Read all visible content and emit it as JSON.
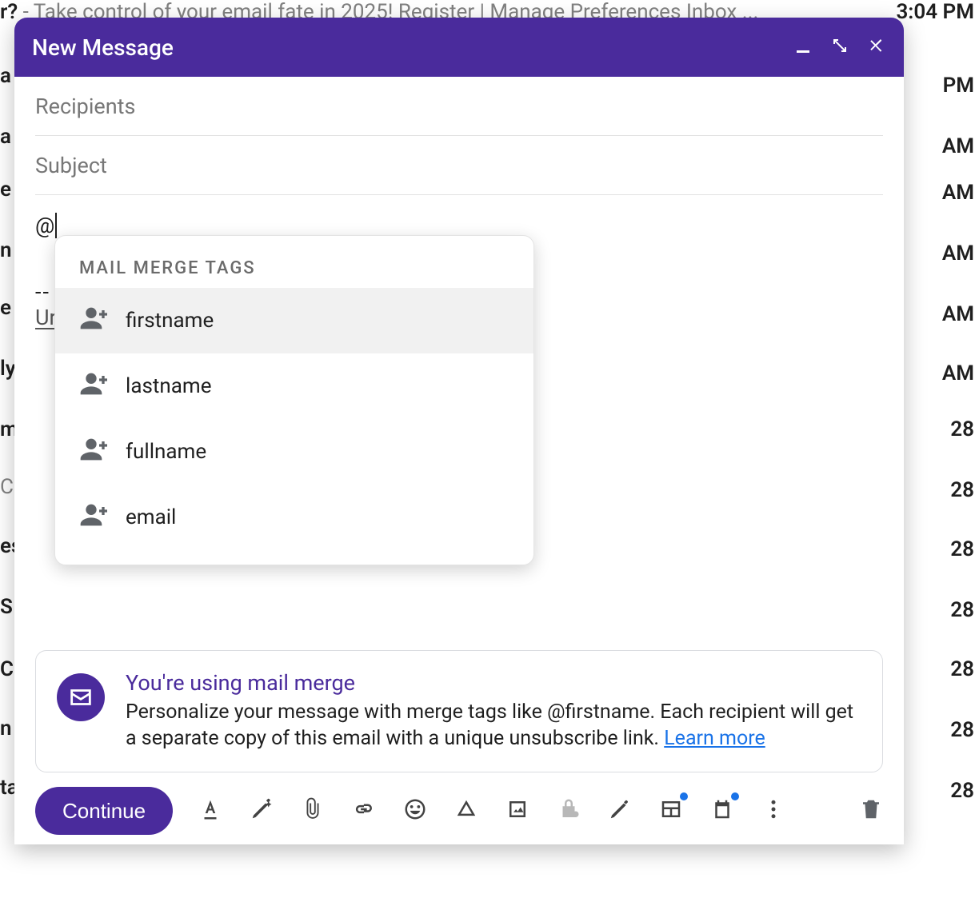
{
  "background": {
    "row0_bold": "r?",
    "row0_rest": " - Take control of your email fate in 2025! Register | Manage Preferences Inbox ...",
    "time0": "3:04 PM",
    "frag_a": "a",
    "frag_e": "e",
    "frag_n": "n",
    "frag_ly": "ly",
    "frag_m": "m",
    "frag_es": "es",
    "frag_S": "S",
    "frag_C": "C",
    "frag_ta": "ta",
    "time_pm": "PM",
    "time_am": "AM",
    "date_28": "28"
  },
  "compose": {
    "title": "New Message",
    "recipients_placeholder": "Recipients",
    "subject_placeholder": "Subject",
    "body_typed": "@",
    "signature_dashes": "--",
    "signature_visible": "Ur"
  },
  "dropdown": {
    "header": "MAIL MERGE TAGS",
    "items": [
      "firstname",
      "lastname",
      "fullname",
      "email"
    ],
    "highlighted_index": 0
  },
  "banner": {
    "title": "You're using mail merge",
    "text_before_link": "Personalize your message with merge tags like @firstname. Each recipient will get a separate copy of this email with a unique unsubscribe link. ",
    "link": "Learn more"
  },
  "toolbar": {
    "send_label": "Continue"
  },
  "colors": {
    "primary": "#4a2b9c",
    "link": "#1a73e8"
  }
}
